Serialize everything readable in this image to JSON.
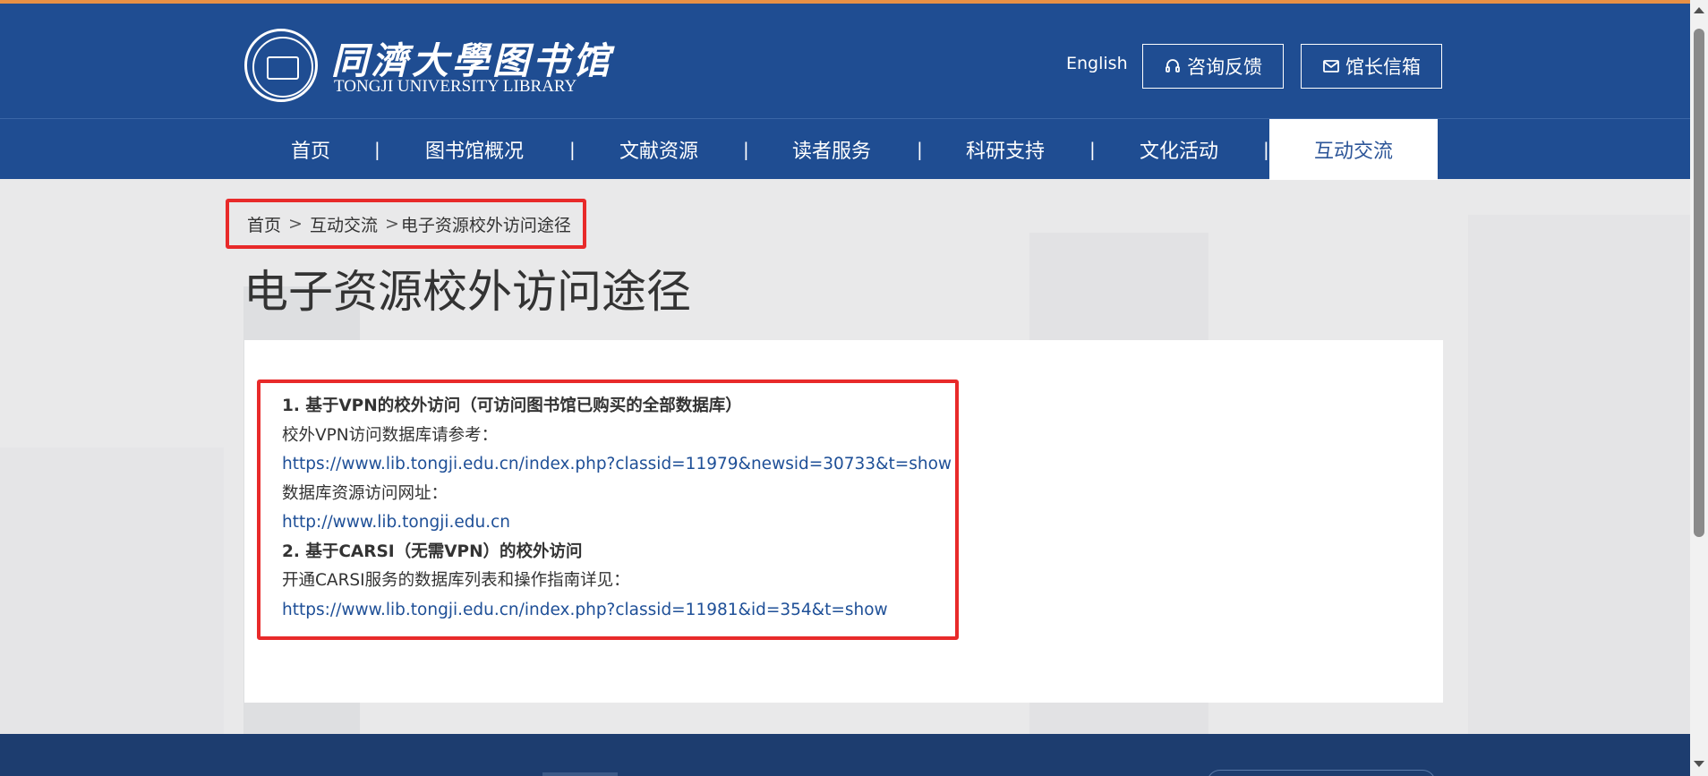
{
  "colors": {
    "header_blue": "#1f4d92",
    "accent_orange": "#e89045",
    "highlight_red": "#e82a2a",
    "link_blue": "#1e4f97",
    "footer_navy": "#1d3d6f"
  },
  "header": {
    "logo_cn": "同濟大學图书馆",
    "logo_en": "TONGJI UNIVERSITY LIBRARY",
    "lang_link": "English",
    "consult_button": "咨询反馈",
    "consult_icon": "headset-icon",
    "mail_button": "馆长信箱",
    "mail_icon": "envelope-icon"
  },
  "nav": {
    "items": [
      "首页",
      "图书馆概况",
      "文献资源",
      "读者服务",
      "科研支持",
      "文化活动",
      "互动交流"
    ],
    "separator": "|",
    "active": "互动交流"
  },
  "breadcrumb": {
    "home": "首页",
    "section": "互动交流",
    "current": "电子资源校外访问途径",
    "separator": ">"
  },
  "page": {
    "title": "电子资源校外访问途径"
  },
  "content": {
    "heading1": "1. 基于VPN的校外访问（可访问图书馆已购买的全部数据库）",
    "text1": "校外VPN访问数据库请参考：",
    "link1": "https://www.lib.tongji.edu.cn/index.php?classid=11979&newsid=30733&t=show",
    "text2": "数据库资源访问网址：",
    "link2": "http://www.lib.tongji.edu.cn",
    "heading2": "2. 基于CARSI（无需VPN）的校外访问",
    "text3": "开通CARSI服务的数据库列表和操作指南详见：",
    "link3": "https://www.lib.tongji.edu.cn/index.php?classid=11981&id=354&t=show"
  }
}
